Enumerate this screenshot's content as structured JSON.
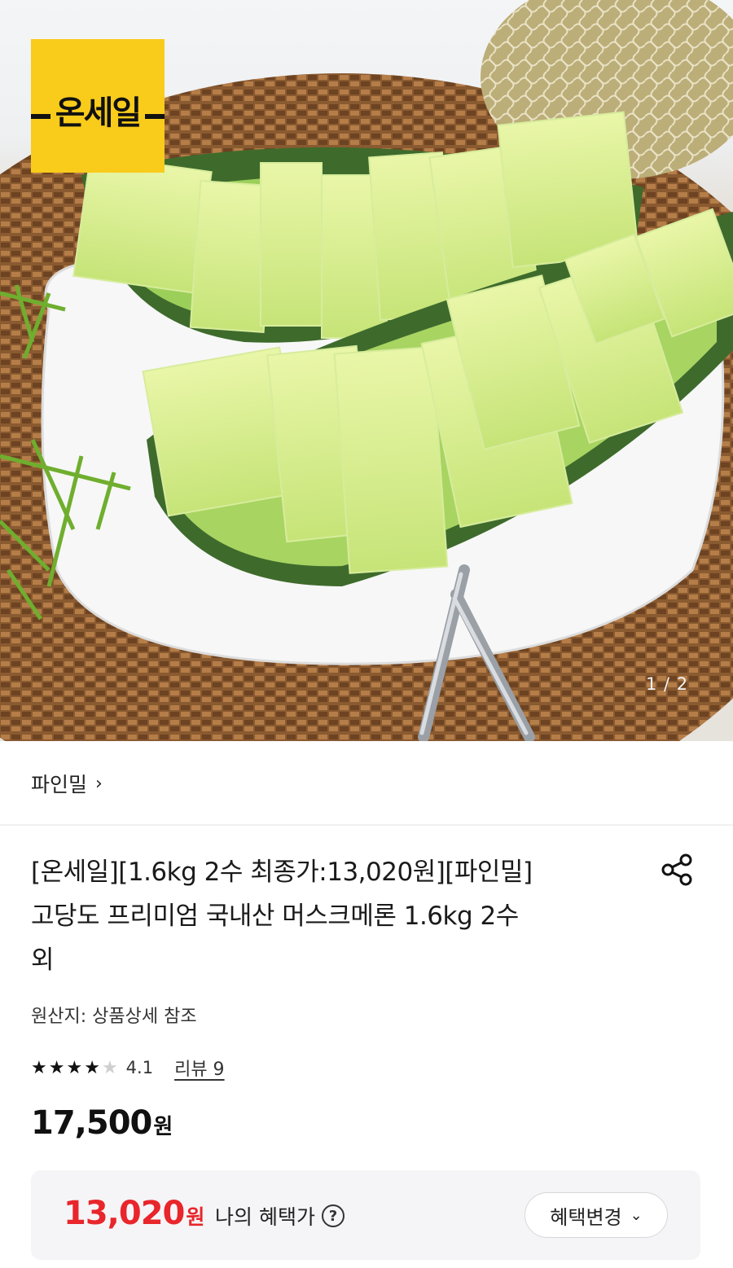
{
  "hero": {
    "brand_badge": "온세일",
    "image_counter": "1 / 2"
  },
  "seller": {
    "name": "파인밀",
    "chevron": "›"
  },
  "product": {
    "title_line1": "[온세일][1.6kg 2수 최종가:13,020원][파인밀]",
    "title_line2": "고당도 프리미엄 국내산 머스크메론 1.6kg 2수",
    "title_line3": "외",
    "origin": "원산지: 상품상세 참조",
    "share_icon": "share-icon"
  },
  "rating": {
    "stars_filled": 4,
    "stars_total": 5,
    "score": "4.1",
    "review_link": "리뷰 9"
  },
  "price": {
    "amount": "17,500",
    "unit": "원"
  },
  "benefit": {
    "amount": "13,020",
    "unit": "원",
    "label": "나의 혜택가",
    "help_icon": "?",
    "change_button": "혜택변경",
    "accent_color": "#e8262b"
  }
}
